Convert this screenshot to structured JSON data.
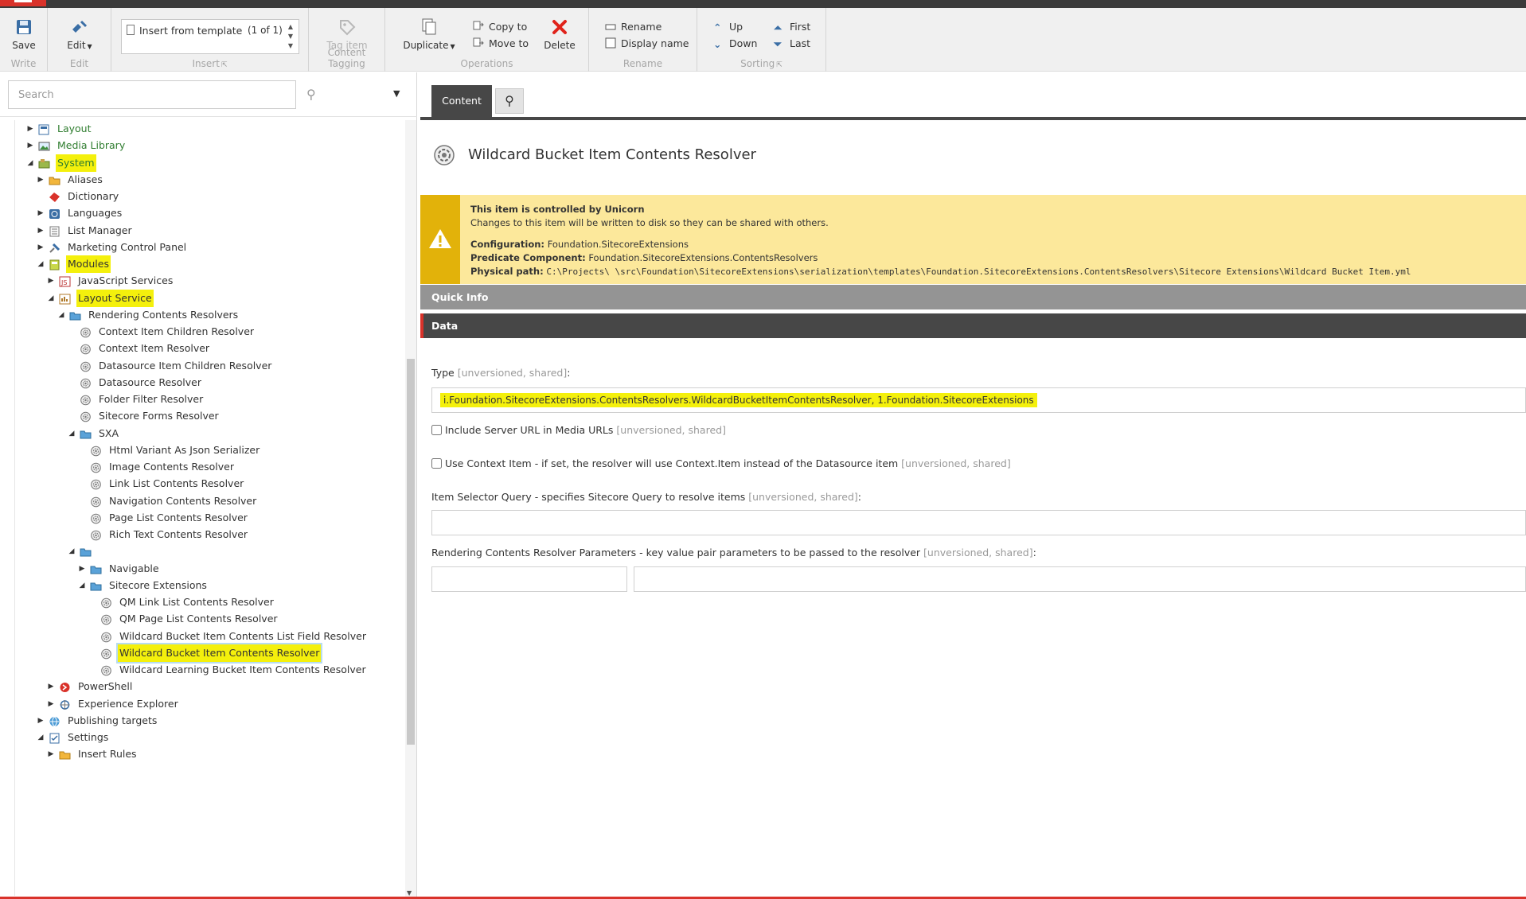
{
  "ribbon": {
    "write": {
      "group_label": "Write",
      "save_label": "Save"
    },
    "edit": {
      "group_label": "Edit",
      "edit_label": "Edit"
    },
    "insert": {
      "group_label": "Insert",
      "gallery_text": "Insert from template",
      "gallery_count": "(1 of 1)"
    },
    "tagging": {
      "group_label": "Content Tagging",
      "tag_label": "Tag item"
    },
    "operations": {
      "group_label": "Operations",
      "duplicate_label": "Duplicate",
      "copy_label": "Copy to",
      "move_label": "Move to",
      "delete_label": "Delete"
    },
    "rename": {
      "group_label": "Rename",
      "rename_label": "Rename",
      "display_name_label": "Display name"
    },
    "sorting": {
      "group_label": "Sorting",
      "up_label": "Up",
      "down_label": "Down",
      "first_label": "First",
      "last_label": "Last"
    }
  },
  "search": {
    "placeholder": "Search"
  },
  "tree": [
    {
      "label": "Layout",
      "level": 1,
      "toggle": "collapsed",
      "icon": "layout-icon",
      "hl": false,
      "color": "#2f7d2f"
    },
    {
      "label": "Media Library",
      "level": 1,
      "toggle": "collapsed",
      "icon": "image-icon",
      "hl": false,
      "color": "#2f7d2f"
    },
    {
      "label": "System",
      "level": 1,
      "toggle": "expanded",
      "icon": "system-icon",
      "hl": true,
      "color": "#2f7d2f"
    },
    {
      "label": "Aliases",
      "level": 2,
      "toggle": "collapsed",
      "icon": "folder-icon",
      "hl": false
    },
    {
      "label": "Dictionary",
      "level": 2,
      "toggle": "none",
      "icon": "dictionary-icon",
      "hl": false
    },
    {
      "label": "Languages",
      "level": 2,
      "toggle": "collapsed",
      "icon": "globe-icon",
      "hl": false
    },
    {
      "label": "List Manager",
      "level": 2,
      "toggle": "collapsed",
      "icon": "list-icon",
      "hl": false
    },
    {
      "label": "Marketing Control Panel",
      "level": 2,
      "toggle": "collapsed",
      "icon": "satellite-icon",
      "hl": false
    },
    {
      "label": "Modules",
      "level": 2,
      "toggle": "expanded",
      "icon": "modules-icon",
      "hl": true
    },
    {
      "label": "JavaScript Services",
      "level": 3,
      "toggle": "collapsed",
      "icon": "js-icon",
      "hl": false
    },
    {
      "label": "Layout Service",
      "level": 3,
      "toggle": "expanded",
      "icon": "layout-service-icon",
      "hl": true
    },
    {
      "label": "Rendering Contents Resolvers",
      "level": 4,
      "toggle": "expanded",
      "icon": "blue-folder-icon",
      "hl": false
    },
    {
      "label": "Context Item Children Resolver",
      "level": 5,
      "toggle": "none",
      "icon": "gear-icon",
      "hl": false
    },
    {
      "label": "Context Item Resolver",
      "level": 5,
      "toggle": "none",
      "icon": "gear-icon",
      "hl": false
    },
    {
      "label": "Datasource Item Children Resolver",
      "level": 5,
      "toggle": "none",
      "icon": "gear-icon",
      "hl": false
    },
    {
      "label": "Datasource Resolver",
      "level": 5,
      "toggle": "none",
      "icon": "gear-icon",
      "hl": false
    },
    {
      "label": "Folder Filter Resolver",
      "level": 5,
      "toggle": "none",
      "icon": "gear-icon",
      "hl": false
    },
    {
      "label": "Sitecore Forms Resolver",
      "level": 5,
      "toggle": "none",
      "icon": "gear-icon",
      "hl": false
    },
    {
      "label": "SXA",
      "level": 5,
      "toggle": "expanded",
      "icon": "blue-folder-icon",
      "hl": false
    },
    {
      "label": "Html Variant As Json Serializer",
      "level": 6,
      "toggle": "none",
      "icon": "gear-icon",
      "hl": false
    },
    {
      "label": "Image Contents Resolver",
      "level": 6,
      "toggle": "none",
      "icon": "gear-icon",
      "hl": false
    },
    {
      "label": "Link List Contents Resolver",
      "level": 6,
      "toggle": "none",
      "icon": "gear-icon",
      "hl": false
    },
    {
      "label": "Navigation Contents Resolver",
      "level": 6,
      "toggle": "none",
      "icon": "gear-icon",
      "hl": false
    },
    {
      "label": "Page List Contents Resolver",
      "level": 6,
      "toggle": "none",
      "icon": "gear-icon",
      "hl": false
    },
    {
      "label": "Rich Text Contents Resolver",
      "level": 6,
      "toggle": "none",
      "icon": "gear-icon",
      "hl": false
    },
    {
      "label": "",
      "level": 5,
      "toggle": "expanded",
      "icon": "blue-folder-icon",
      "hl": false
    },
    {
      "label": "Navigable",
      "level": 6,
      "toggle": "collapsed",
      "icon": "blue-folder-icon",
      "hl": false
    },
    {
      "label": "Sitecore Extensions",
      "level": 6,
      "toggle": "expanded",
      "icon": "blue-folder-icon",
      "hl": false
    },
    {
      "label": "QM Link List Contents Resolver",
      "level": 7,
      "toggle": "none",
      "icon": "gear-icon",
      "hl": false
    },
    {
      "label": "QM Page List Contents Resolver",
      "level": 7,
      "toggle": "none",
      "icon": "gear-icon",
      "hl": false
    },
    {
      "label": "Wildcard Bucket Item Contents List Field Resolver",
      "level": 7,
      "toggle": "none",
      "icon": "gear-icon",
      "hl": false
    },
    {
      "label": "Wildcard Bucket Item Contents Resolver",
      "level": 7,
      "toggle": "none",
      "icon": "gear-icon",
      "hl": true,
      "selected": true
    },
    {
      "label": "Wildcard Learning Bucket Item Contents Resolver",
      "level": 7,
      "toggle": "none",
      "icon": "gear-icon",
      "hl": false
    },
    {
      "label": "PowerShell",
      "level": 3,
      "toggle": "collapsed",
      "icon": "powershell-icon",
      "hl": false
    },
    {
      "label": "Experience Explorer",
      "level": 3,
      "toggle": "collapsed",
      "icon": "explorer-icon",
      "hl": false
    },
    {
      "label": "Publishing targets",
      "level": 2,
      "toggle": "collapsed",
      "icon": "publishing-icon",
      "hl": false
    },
    {
      "label": "Settings",
      "level": 2,
      "toggle": "expanded",
      "icon": "settings-icon",
      "hl": false
    },
    {
      "label": "Insert Rules",
      "level": 3,
      "toggle": "collapsed",
      "icon": "folder-icon",
      "hl": false
    }
  ],
  "editor": {
    "tab_content": "Content",
    "item_title": "Wildcard Bucket Item Contents Resolver",
    "warning": {
      "title": "This item is controlled by Unicorn",
      "subtitle": "Changes to this item will be written to disk so they can be shared with others.",
      "config_label": "Configuration:",
      "config_value": "Foundation.SitecoreExtensions",
      "predicate_label": "Predicate Component:",
      "predicate_value": "Foundation.SitecoreExtensions.ContentsResolvers",
      "path_label": "Physical path:",
      "path_value": "C:\\Projects\\           \\src\\Foundation\\SitecoreExtensions\\serialization\\templates\\Foundation.SitecoreExtensions.ContentsResolvers\\Sitecore Extensions\\Wildcard Bucket Item.yml"
    },
    "section_quick": "Quick Info",
    "section_data": "Data",
    "fields": {
      "type_label": "Type",
      "type_meta": "[unversioned, shared]",
      "type_value": "i.Foundation.SitecoreExtensions.ContentsResolvers.WildcardBucketItemContentsResolver,     1.Foundation.SitecoreExtensions",
      "server_url_label": "Include Server URL in Media URLs",
      "server_url_meta": "[unversioned, shared]",
      "context_item_label": "Use Context Item - if set, the resolver will use Context.Item instead of the Datasource item",
      "context_item_meta": "[unversioned, shared]",
      "query_label": "Item Selector Query - specifies Sitecore Query to resolve items",
      "query_meta": "[unversioned, shared]",
      "params_label": "Rendering Contents Resolver Parameters - key value pair parameters to be passed to the resolver",
      "params_meta": "[unversioned, shared]"
    }
  },
  "colors": {
    "accent_red": "#d9322a",
    "highlight_yellow": "#f4f00c",
    "tab_dark": "#474747",
    "warning_bg": "#fce89b",
    "warning_bar": "#e2b20a"
  }
}
